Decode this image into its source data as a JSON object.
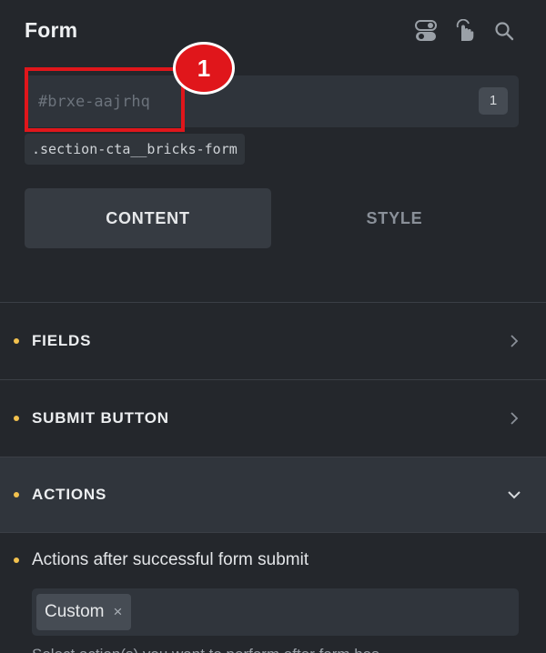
{
  "header": {
    "title": "Form",
    "icons": [
      "toggle-icon",
      "pointer-hand-icon",
      "search-icon"
    ]
  },
  "element_id": {
    "placeholder": "#brxe-aajrhq",
    "count": "1"
  },
  "css_class": ".section-cta__bricks-form",
  "annotation": {
    "badge_number": "1",
    "color": "#e0161b"
  },
  "tabs": [
    {
      "label": "CONTENT",
      "active": true
    },
    {
      "label": "STYLE",
      "active": false
    }
  ],
  "sections": [
    {
      "label": "FIELDS",
      "state": "collapsed"
    },
    {
      "label": "SUBMIT BUTTON",
      "state": "collapsed"
    },
    {
      "label": "ACTIONS",
      "state": "expanded"
    }
  ],
  "actions": {
    "label": "Actions after successful form submit",
    "selected": [
      "Custom"
    ],
    "remove_glyph": "×",
    "helper_text_partial": "Select action(s) you want to perform after form has"
  },
  "colors": {
    "background": "#24272c",
    "accent_dot": "#f2c14e",
    "highlight_red": "#e0161b"
  }
}
